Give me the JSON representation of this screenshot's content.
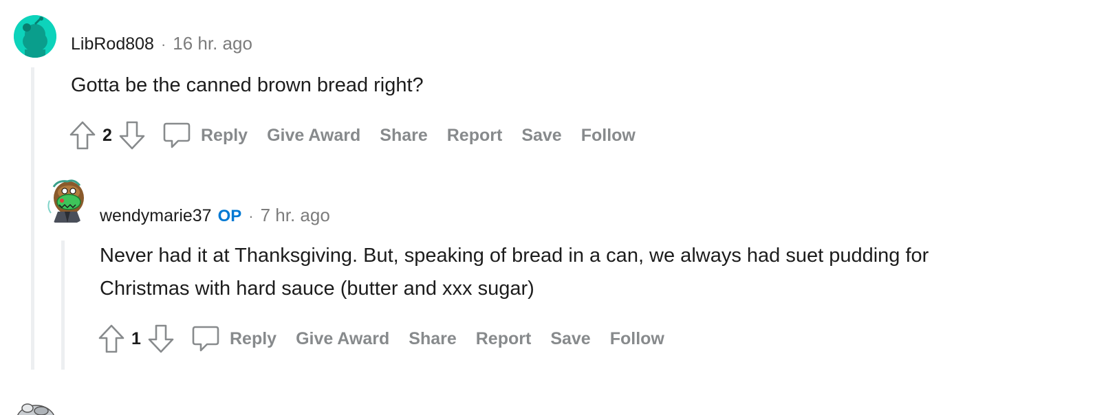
{
  "comments": [
    {
      "username": "LibRod808",
      "separator": "·",
      "timestamp": "16 hr. ago",
      "body": "Gotta be the canned brown bread right?",
      "score": "2",
      "actions": {
        "reply": "Reply",
        "give_award": "Give Award",
        "share": "Share",
        "report": "Report",
        "save": "Save",
        "follow": "Follow"
      }
    },
    {
      "username": "wendymarie37",
      "op_badge": "OP",
      "separator": "·",
      "timestamp": "7 hr. ago",
      "body_line1": "Never had it at Thanksgiving. But, speaking of bread in a can, we always had suet pudding for",
      "body_line2": "Christmas with hard sauce (butter and xxx sugar)",
      "score": "1",
      "actions": {
        "reply": "Reply",
        "give_award": "Give Award",
        "share": "Share",
        "report": "Report",
        "save": "Save",
        "follow": "Follow"
      }
    }
  ],
  "icons": {
    "upvote": "arrow-up-outline",
    "downvote": "arrow-down-outline",
    "reply": "speech-bubble-outline"
  },
  "colors": {
    "text": "#1c1c1c",
    "muted": "#878a8c",
    "op": "#0079d3",
    "thread_line": "#edeff1",
    "avatar_teal": "#0dd3bb"
  }
}
